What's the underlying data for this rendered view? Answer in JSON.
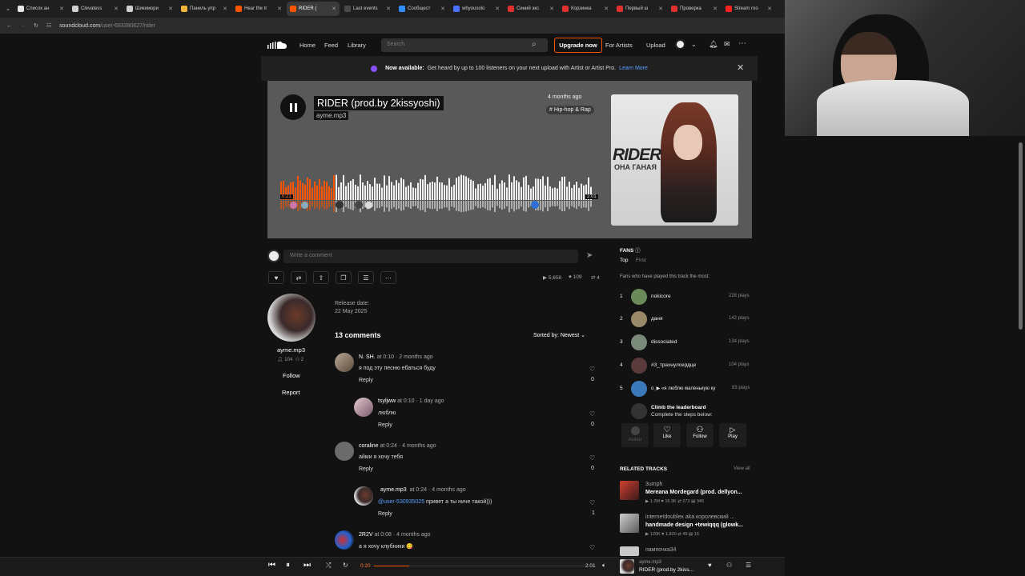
{
  "browser": {
    "tabs": [
      {
        "label": "Список ан",
        "color": "#e6e6e6"
      },
      {
        "label": "Clevatess",
        "color": "#cfcfcf"
      },
      {
        "label": "Шикимори",
        "color": "#cfcfcf"
      },
      {
        "label": "Панель упр",
        "color": "#f0b53b"
      },
      {
        "label": "Hear the tr",
        "color": "#ff5500"
      },
      {
        "label": "RIDER (",
        "color": "#ff5500",
        "active": true
      },
      {
        "label": "Last events",
        "color": "#4a4a4a"
      },
      {
        "label": "Сообщест",
        "color": "#2f8cff"
      },
      {
        "label": "whyousolo",
        "color": "#4a72ff"
      },
      {
        "label": "Синий экс",
        "color": "#e03030"
      },
      {
        "label": "Корзинка",
        "color": "#e03030"
      },
      {
        "label": "Первый ш",
        "color": "#e03030"
      },
      {
        "label": "Проверка",
        "color": "#e03030"
      },
      {
        "label": "Stream roo",
        "color": "#ff2020"
      }
    ],
    "url_host": "soundcloud.com",
    "url_path": "/user-693390627/rider"
  },
  "header": {
    "nav": [
      "Home",
      "Feed",
      "Library"
    ],
    "search_placeholder": "Search",
    "upgrade": "Upgrade now",
    "for_artists": "For Artists",
    "upload": "Upload"
  },
  "banner": {
    "lead": "Now available:",
    "text": "Get heard by up to 100 listeners on your next upload with Artist or Artist Pro.",
    "link": "Learn More"
  },
  "track": {
    "title": "RIDER (prod.by 2kissyoshi)",
    "artist": "ayme.mp3",
    "ago": "4 months ago",
    "genre": "# Hip-hop & Rap",
    "elapsed": "0:21",
    "duration": "2:01",
    "progress": 0.174,
    "cover_text_1": "RIDER",
    "cover_text_2": "ОНА ГАНАЯ"
  },
  "comment_input": {
    "placeholder": "Write a comment"
  },
  "stats": {
    "plays": "5,658",
    "likes": "109",
    "reposts": "4"
  },
  "uploader": {
    "name": "ayme.mp3",
    "followers": "104",
    "following": "2",
    "follow": "Follow",
    "report": "Report"
  },
  "release": {
    "label": "Release date:",
    "date": "22 May 2025"
  },
  "comments_header": {
    "count": "13 comments",
    "sort": "Sorted by: Newest"
  },
  "comments": [
    {
      "user": "N. SH.",
      "time": "0:10",
      "ago": "2 months ago",
      "text": "я под эту песню ебаться буду",
      "likes": "0",
      "reply": "Reply",
      "color": "#7a6a5a"
    },
    {
      "user": "tsyljww",
      "time": "0:10",
      "ago": "1 day ago",
      "text": "люблю",
      "likes": "0",
      "reply": "Reply",
      "color": "#9a7a8a"
    },
    {
      "user": "coraline",
      "time": "0:24",
      "ago": "4 months ago",
      "text": "айми я хочу тебя",
      "likes": "0",
      "reply": "Reply",
      "color": "#6b6b6b"
    },
    {
      "user": "ayme.mp3",
      "time": "0:24",
      "ago": "4 months ago",
      "mention": "@user-530935025",
      "text": " привет а ты ниче такой)))",
      "likes": "1",
      "reply": "Reply",
      "color": "#c9c9c9"
    },
    {
      "user": "2R2V",
      "time": "0:08",
      "ago": "4 months ago",
      "text": "а я хочу клубники 😋",
      "color": "#2060d0"
    }
  ],
  "fans": {
    "title": "FANS",
    "tab_top": "Top",
    "tab_first": "First",
    "subtitle": "Fans who have played this track the most:",
    "list": [
      {
        "rank": "1",
        "name": "nokicore",
        "plays": "228 plays",
        "color": "#6a8a5a"
      },
      {
        "rank": "2",
        "name": "даня",
        "plays": "142 plays",
        "color": "#9a8a6a"
      },
      {
        "rank": "3",
        "name": "dissociated",
        "plays": "134 plays",
        "color": "#7a8a7a"
      },
      {
        "rank": "4",
        "name": "#3_трахнулсердце",
        "plays": "104 plays",
        "color": "#5a3a3a"
      },
      {
        "rank": "5",
        "name": "o ̗̀ ▶ «я люблю маленькую ку",
        "plays": "83 plays",
        "color": "#3a7aba"
      }
    ],
    "climb_title": "Climb the leaderboard",
    "climb_sub": "Complete the steps below:",
    "steps": [
      "Avatar",
      "Like",
      "Follow",
      "Play"
    ]
  },
  "related": {
    "title": "RELATED TRACKS",
    "view_all": "View all",
    "tracks": [
      {
        "artist": "3umph",
        "title": "Mereana Mordegard (prod. dellyon...",
        "plays": "1.2M",
        "likes": "16.3K",
        "reposts": "273",
        "comments": "345",
        "color": "#b03020"
      },
      {
        "artist": "internetdoublex aka королевский ...",
        "title": "handmade design +tewiqqq (glowk...",
        "plays": "120K",
        "likes": "1,820",
        "reposts": "45",
        "comments": "16",
        "color": "#8a8a8a"
      },
      {
        "artist": "пампочка34",
        "title": "",
        "color": "#c9c9c9"
      }
    ]
  },
  "player": {
    "elapsed": "0:20",
    "duration": "2:01",
    "progress": 0.165,
    "artist": "ayme.mp3",
    "title": "RIDER (prod.by 2kiss..."
  },
  "colors": {
    "accent": "#ff5500",
    "bg": "#121212",
    "hero": "#595959"
  }
}
